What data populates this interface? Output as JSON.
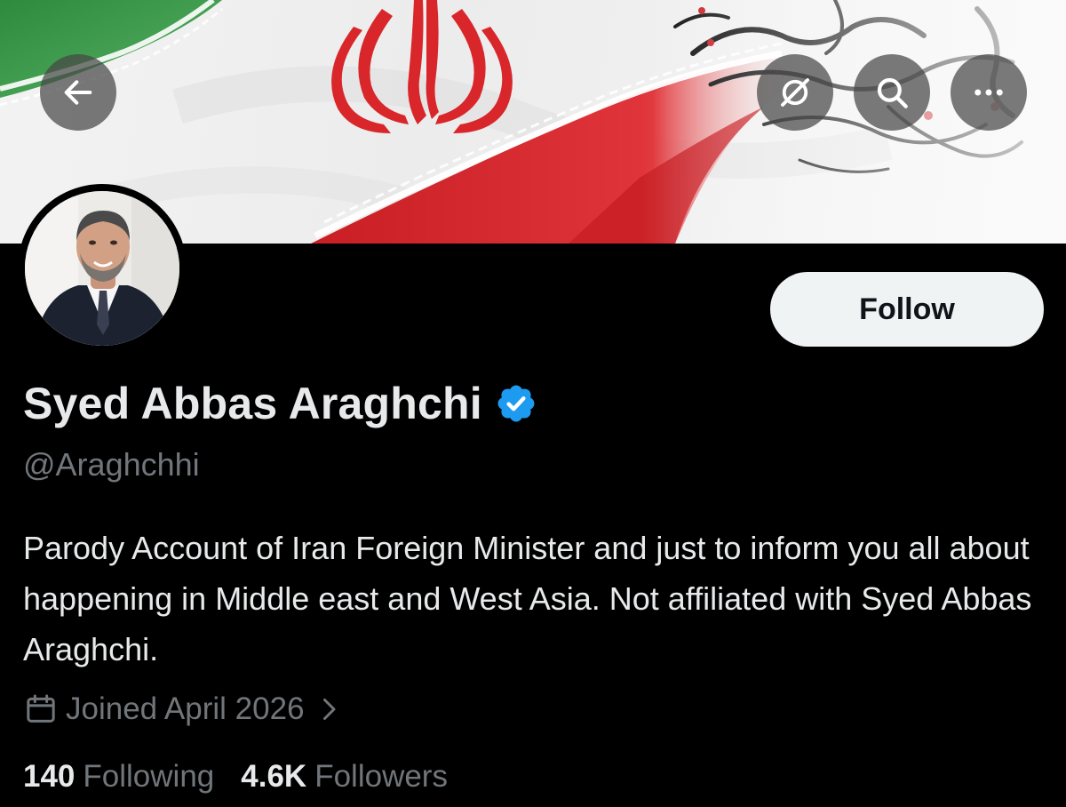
{
  "profile": {
    "name": "Syed Abbas Araghchi",
    "handle": "@Araghchhi",
    "follow_label": "Follow",
    "bio": "Parody Account of Iran Foreign Minister and just to inform you all about happening in Middle east and West Asia. Not affiliated with Syed Abbas Araghchi.",
    "joined": "Joined April 2026",
    "following_count": "140",
    "following_label": "Following",
    "followers_count": "4.6K",
    "followers_label": "Followers",
    "verified": true
  },
  "header": {
    "back_icon": "arrow-left-icon",
    "grok_icon": "grok-icon",
    "search_icon": "search-icon",
    "more_icon": "more-icon"
  },
  "colors": {
    "background": "#000000",
    "primary_text": "#e7e9ea",
    "secondary_text": "#71767b",
    "verified_blue": "#1d9bf0",
    "flag_green": "#3a9a4a",
    "flag_red": "#d8262a"
  }
}
